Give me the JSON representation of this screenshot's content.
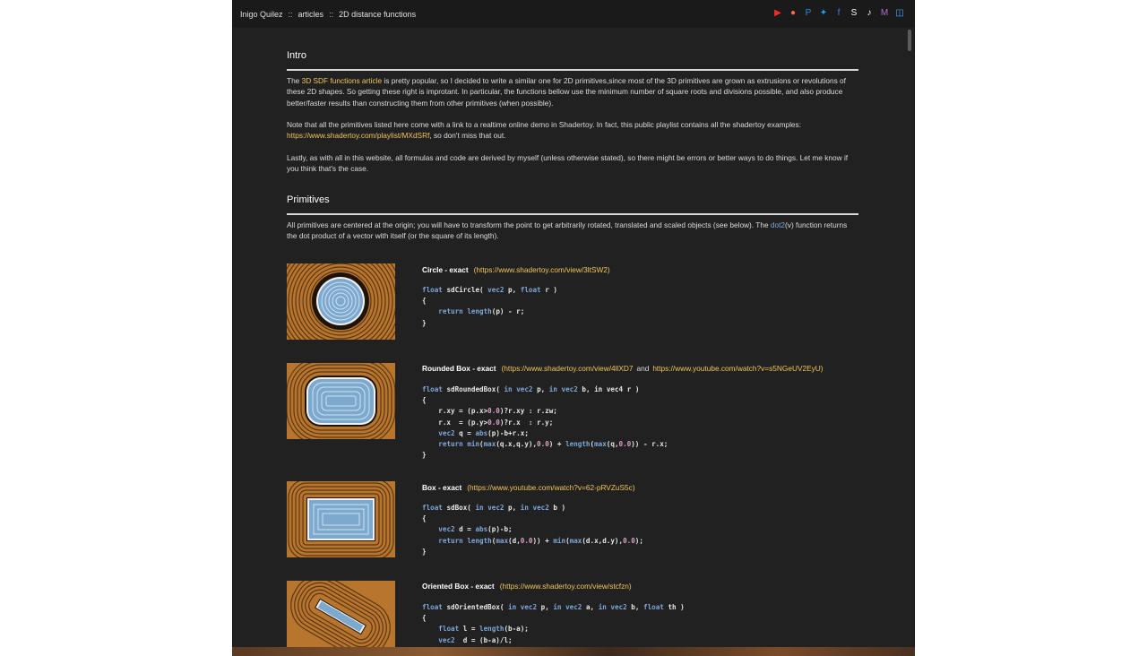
{
  "breadcrumb": {
    "author": "Inigo Quilez",
    "sep": "::",
    "section": "articles",
    "page": "2D distance functions"
  },
  "social_icons": [
    {
      "name": "youtube-icon",
      "glyph": "▶",
      "color": "#ff2a2a"
    },
    {
      "name": "patreon-icon",
      "glyph": "●",
      "color": "#f96854"
    },
    {
      "name": "paypal-icon",
      "glyph": "P",
      "color": "#2c8ed6"
    },
    {
      "name": "twitter-icon",
      "glyph": "✦",
      "color": "#1da1f2"
    },
    {
      "name": "facebook-icon",
      "glyph": "f",
      "color": "#3b82f6"
    },
    {
      "name": "sketchfab-icon",
      "glyph": "S",
      "color": "#ffffff"
    },
    {
      "name": "tiktok-icon",
      "glyph": "♪",
      "color": "#ffffff"
    },
    {
      "name": "mastodon-icon",
      "glyph": "M",
      "color": "#b26ad6"
    },
    {
      "name": "bluesky-icon",
      "glyph": "◫",
      "color": "#4aa3ff"
    }
  ],
  "intro": {
    "heading": "Intro",
    "p1_link": "3D SDF functions article",
    "p1_a": "The",
    "p1_b": "is pretty popular, so I decided to write a similar one for 2D primitives,since most of the 3D primitives are grown as extrusions or revolutions of these 2D shapes. So getting these right is improtant. In particular, the functions bellow use the minimum number of square roots and divisions possible, and also produce better/faster results than constructing them from other primitives (when possible).",
    "p2_a": "Note that all the primitives listed here come with a link to a realtime online demo in Shadertoy. In fact, this public playlist contains all the shadertoy examples:",
    "p2_link": "https://www.shadertoy.com/playlist/MXdSRf",
    "p2_b": ", so don't miss that out.",
    "p3": "Lastly, as with all in this website, all formulas and code are derived by myself (unless otherwise stated), so there might be errors or better ways to do things. Let me know if you think that's the case."
  },
  "primitives": {
    "heading": "Primitives",
    "p1_a": "All primitives are centered at the origin; you will have to transform the point to get arbitrarily rotated, translated and scaled objects (see below). The",
    "p1_link": "dot2",
    "p1_b": "(v) function returns the dot product of a vector with itself (or the square of its length)."
  },
  "entries": [
    {
      "title": "Circle - exact",
      "url": "(https://www.shadertoy.com/view/3ltSW2)"
    },
    {
      "title": "Rounded Box - exact",
      "url": "(https://www.shadertoy.com/view/4llXD7",
      "and": "and",
      "url2": "https://www.youtube.com/watch?v=s5NGeUV2EyU)"
    },
    {
      "title": "Box - exact",
      "url": "(https://www.youtube.com/watch?v=62-pRVZuS5c)"
    },
    {
      "title": "Oriented Box - exact",
      "url": "(https://www.shadertoy.com/view/stcfzn)"
    }
  ]
}
